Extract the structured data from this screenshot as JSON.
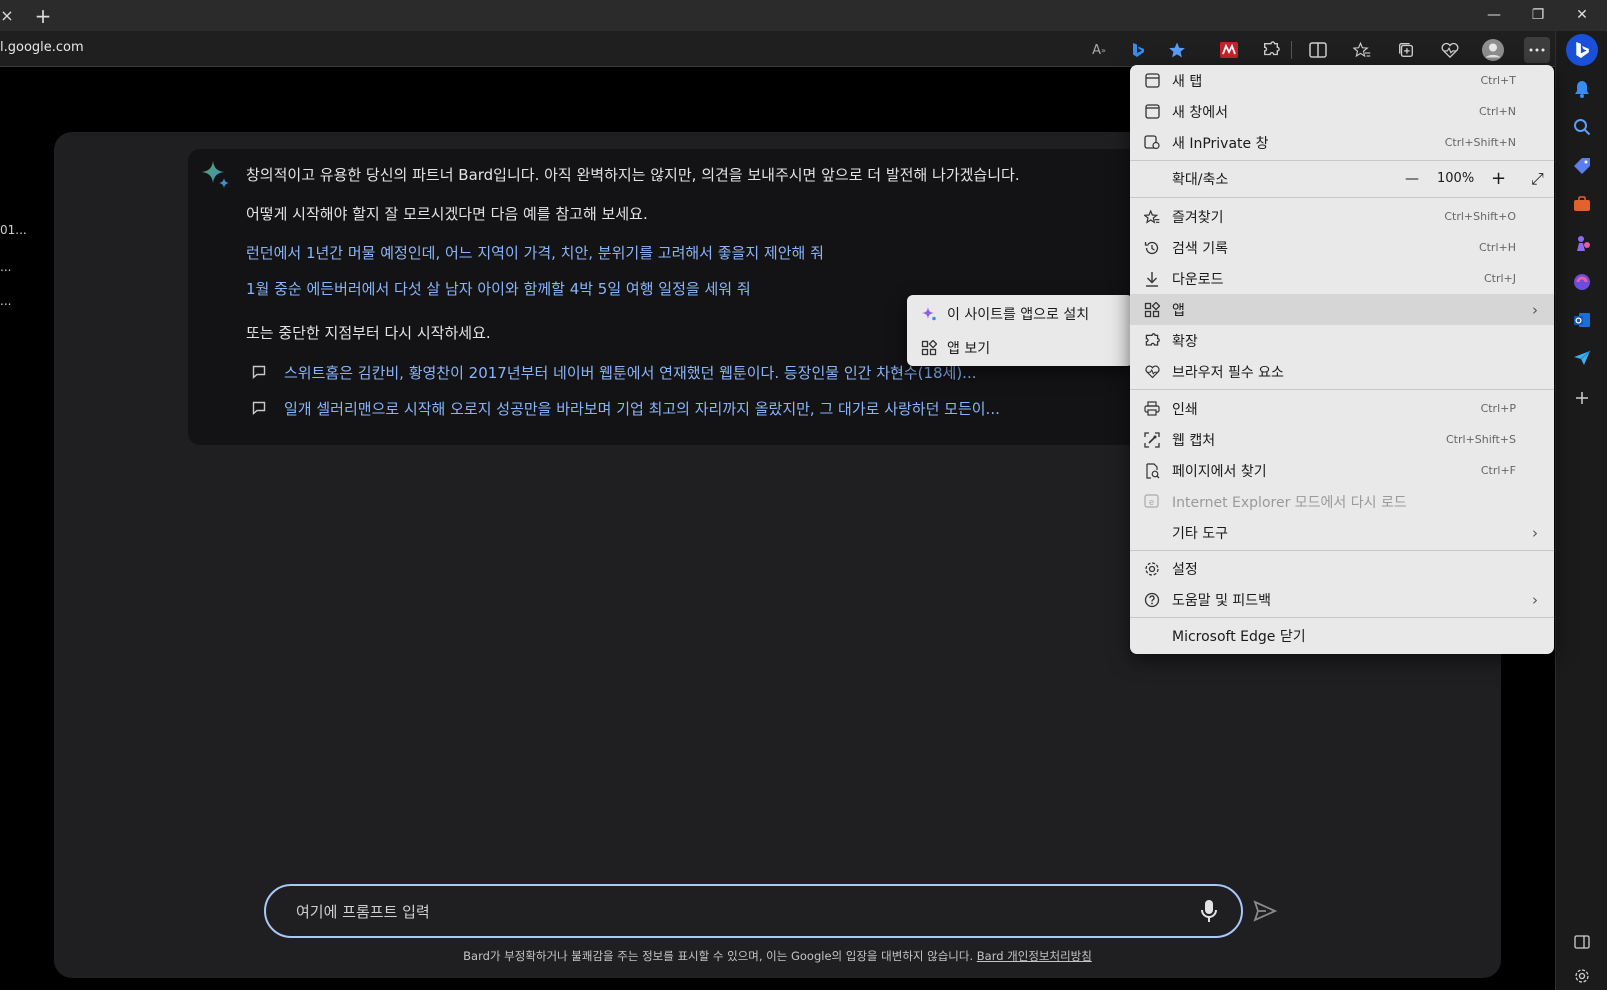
{
  "browser": {
    "url": "l.google.com",
    "tab_close": "×",
    "new_tab": "+",
    "window_controls": {
      "minimize": "—",
      "restore": "❐",
      "close": "✕"
    },
    "read_aloud_glyph": "A",
    "read_aloud_sup": "»",
    "accent_color": "#1a4fd8"
  },
  "sidebar_left_fragments": [
    "01...",
    "...",
    "..."
  ],
  "bard": {
    "intro": "창의적이고 유용한 당신의 파트너 Bard입니다. 아직 완벽하지는 않지만, 의견을 보내주시면 앞으로 더 발전해 나가겠습니다.",
    "how_to_start": "어떻게 시작해야 할지 잘 모르시겠다면 다음 예를 참고해 보세요.",
    "examples": [
      "런던에서 1년간 머물 예정인데, 어느 지역이 가격, 치안, 분위기를 고려해서 좋을지 제안해 줘",
      "1월 중순 에든버러에서 다섯 살 남자 아이와 함께할 4박 5일 여행 일정을 세워 줘"
    ],
    "resume_prompt": "또는 중단한 지점부터 다시 시작하세요.",
    "history": [
      "스위트홈은 김칸비, 황영찬이 2017년부터 네이버 웹툰에서 연재했던 웹툰이다. 등장인물 인간 차현수(18세)...",
      "일개 셀러리맨으로 시작해 오로지 성공만을 바라보며 기업 최고의 자리까지 올랐지만, 그 대가로 사랑하던 모든이..."
    ],
    "prompt_placeholder": "여기에 프롬프트 입력",
    "disclaimer": "Bard가 부정확하거나 불쾌감을 주는 정보를 표시할 수 있으며, 이는 Google의 입장을 대변하지 않습니다. ",
    "privacy_link": "Bard 개인정보처리방침"
  },
  "menu": {
    "new_tab": {
      "label": "새 탭",
      "shortcut": "Ctrl+T"
    },
    "new_window": {
      "label": "새 창에서",
      "shortcut": "Ctrl+N"
    },
    "new_inprivate": {
      "label": "새 InPrivate 창",
      "shortcut": "Ctrl+Shift+N"
    },
    "zoom": {
      "label": "확대/축소",
      "minus": "—",
      "value": "100%",
      "plus": "+",
      "fullscreen": "⤢"
    },
    "favorites": {
      "label": "즐겨찾기",
      "shortcut": "Ctrl+Shift+O"
    },
    "history": {
      "label": "검색 기록",
      "shortcut": "Ctrl+H"
    },
    "downloads": {
      "label": "다운로드",
      "shortcut": "Ctrl+J"
    },
    "apps": {
      "label": "앱",
      "arrow": "›"
    },
    "extensions": {
      "label": "확장"
    },
    "browser_essentials": {
      "label": "브라우저 필수 요소"
    },
    "print": {
      "label": "인쇄",
      "shortcut": "Ctrl+P"
    },
    "web_capture": {
      "label": "웹 캡처",
      "shortcut": "Ctrl+Shift+S"
    },
    "find": {
      "label": "페이지에서 찾기",
      "shortcut": "Ctrl+F"
    },
    "ie_mode": {
      "label": "Internet Explorer 모드에서 다시 로드"
    },
    "more_tools": {
      "label": "기타 도구",
      "arrow": "›"
    },
    "settings": {
      "label": "설정"
    },
    "help": {
      "label": "도움말 및 피드백",
      "arrow": "›"
    },
    "close_edge": {
      "label": "Microsoft Edge 닫기"
    }
  },
  "apps_submenu": {
    "install": "이 사이트를 앱으로 설치",
    "view": "앱 보기"
  }
}
